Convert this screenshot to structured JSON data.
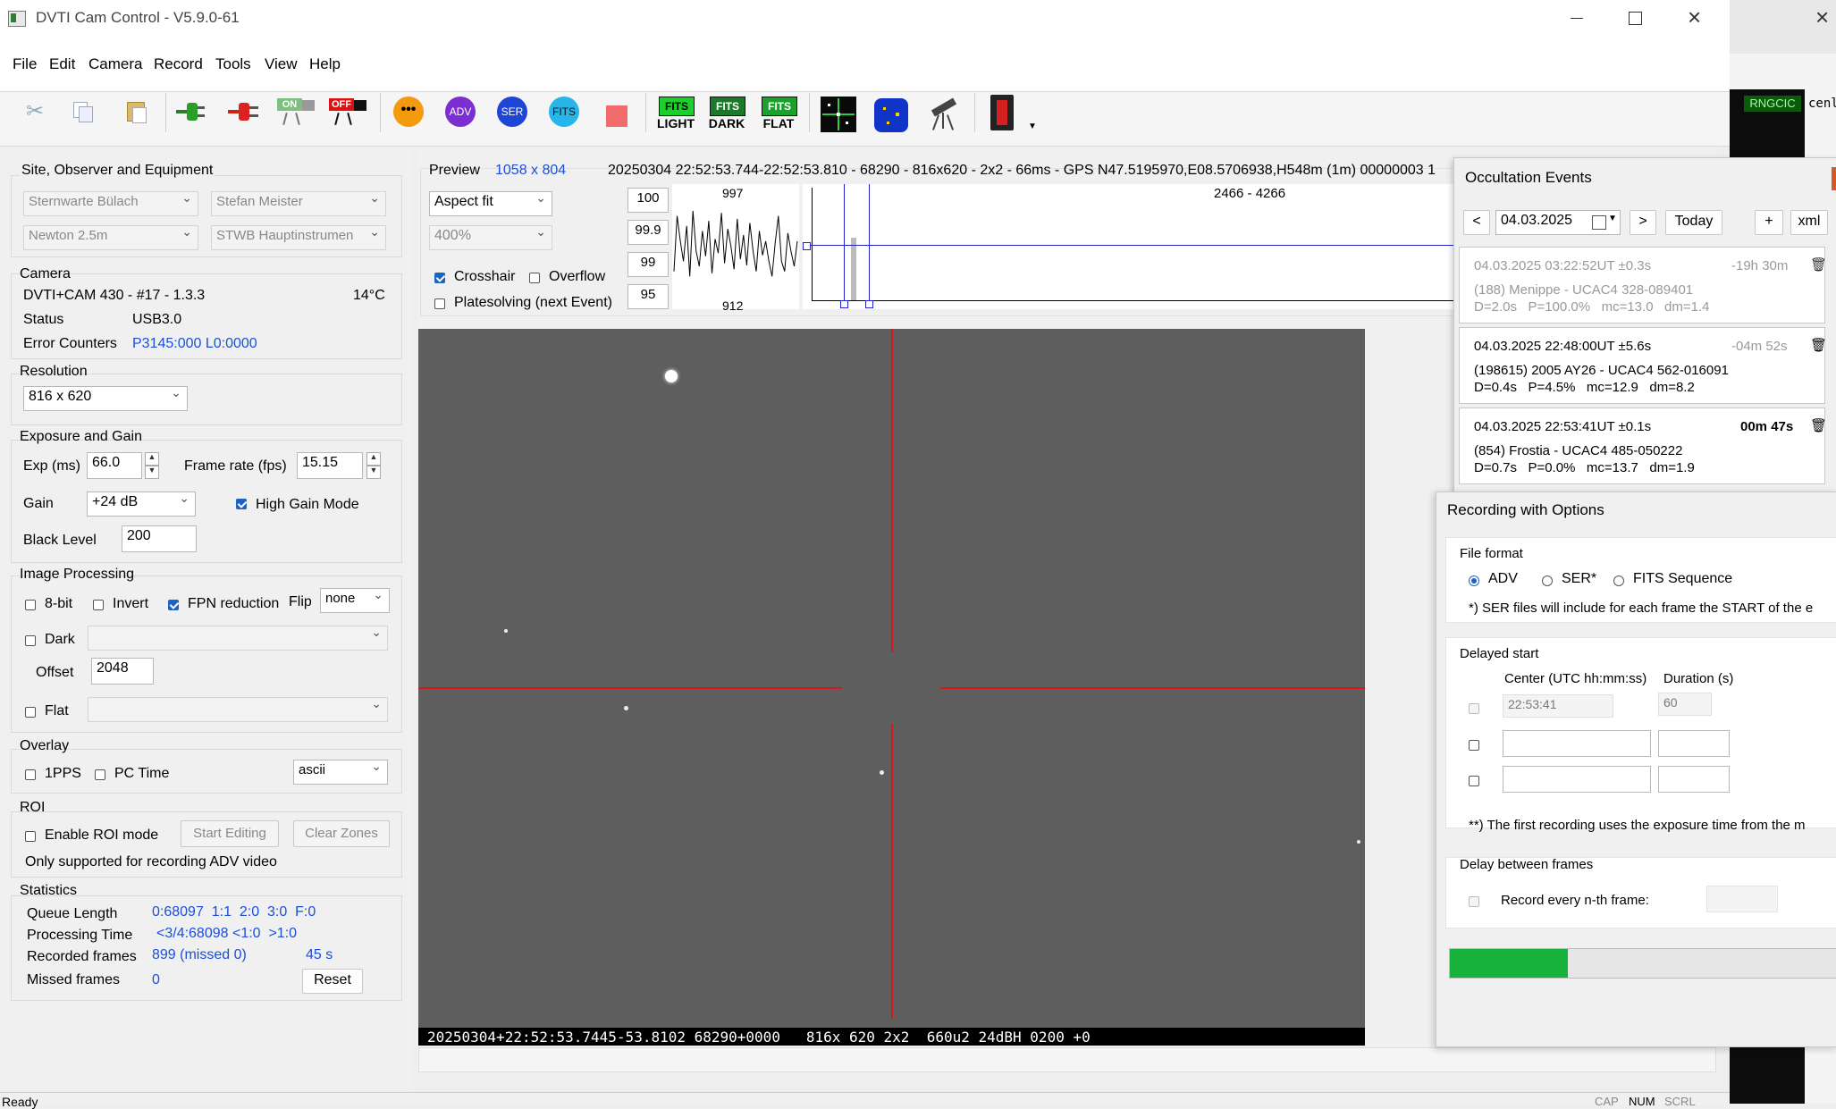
{
  "window": {
    "title": "DVTI Cam Control - V5.9.0-61"
  },
  "menu": [
    "File",
    "Edit",
    "Camera",
    "Record",
    "Tools",
    "View",
    "Help"
  ],
  "toolbar": {
    "on_label": "ON",
    "off_label": "OFF",
    "adv_label": "ADV",
    "ser_label": "SER",
    "fits_label": "FITS",
    "fits_light": [
      "FITS",
      "LIGHT"
    ],
    "fits_dark": [
      "FITS",
      "DARK"
    ],
    "fits_flat": [
      "FITS",
      "FLAT"
    ]
  },
  "site": {
    "title": "Site, Observer and Equipment",
    "observatory": "Sternwarte Bülach",
    "observer": "Stefan Meister",
    "telescope": "Newton 2.5m",
    "instrument": "STWB Hauptinstrumen"
  },
  "camera": {
    "title": "Camera",
    "model": "DVTI+CAM 430  -  #17  -  1.3.3",
    "temperature": "14°C",
    "status_label": "Status",
    "status_value": "USB3.0",
    "errors_label": "Error Counters",
    "errors_value": "P3145:000 L0:0000"
  },
  "resolution": {
    "title": "Resolution",
    "value": "816 x 620"
  },
  "exposure": {
    "title": "Exposure and Gain",
    "exp_label": "Exp (ms)",
    "exp_value": "66.0",
    "fps_label": "Frame rate (fps)",
    "fps_value": "15.15",
    "gain_label": "Gain",
    "gain_value": "+24 dB",
    "hgm_label": "High Gain Mode",
    "black_label": "Black Level",
    "black_value": "200"
  },
  "image_processing": {
    "title": "Image Processing",
    "bit8": "8-bit",
    "invert": "Invert",
    "fpn": "FPN reduction",
    "flip_label": "Flip",
    "flip_value": "none",
    "dark": "Dark",
    "offset_label": "Offset",
    "offset_value": "2048",
    "flat": "Flat"
  },
  "overlay": {
    "title": "Overlay",
    "pps": "1PPS",
    "pctime": "PC Time",
    "format": "ascii"
  },
  "roi": {
    "title": "ROI",
    "enable": "Enable ROI mode",
    "start": "Start Editing",
    "clear": "Clear Zones",
    "note": "Only supported for recording ADV video"
  },
  "stats": {
    "title": "Statistics",
    "queue_label": "Queue Length",
    "queue_value": "0:68097  1:1  2:0  3:0  F:0",
    "proc_label": "Processing Time",
    "proc_value": "<3/4:68098 <1:0  >1:0",
    "rec_label": "Recorded frames",
    "rec_value": "899 (missed 0)",
    "rec_time": "45 s",
    "missed_label": "Missed frames",
    "missed_value": "0",
    "reset": "Reset"
  },
  "preview": {
    "label": "Preview",
    "size": "1058 x 804",
    "info": "20250304 22:52:53.744-22:52:53.810 - 68290 - 816x620 - 2x2 - 66ms - GPS N47.5195970,E08.5706938,H548m (1m) 00000003 1",
    "fit": "Aspect fit",
    "zoom": "400%",
    "crosshair": "Crosshair",
    "overflow": "Overflow",
    "platesolving": "Platesolving (next Event)",
    "levels": [
      "100",
      "99.9",
      "99",
      "95"
    ],
    "hist_max": "997",
    "hist_min": "912",
    "range": "2466 - 4266",
    "timestamp": "20250304+22:52:53.7445-53.8102 68290+0000   816x 620 2x2  660u2 24dBH 0200 +0"
  },
  "chart_data": {
    "type": "line",
    "title": "",
    "ylim": [
      912,
      997
    ],
    "values": [
      930,
      985,
      960,
      940,
      975,
      925,
      990,
      950,
      935,
      970,
      945,
      980,
      928,
      962,
      948,
      988,
      938,
      972,
      955,
      932,
      982,
      942,
      966,
      936,
      978,
      950,
      930,
      970,
      946,
      960,
      940,
      925,
      958,
      985,
      940,
      930,
      968,
      950,
      935,
      960
    ]
  },
  "occultation": {
    "title": "Occultation Events",
    "date": "04.03.2025",
    "prev": "<",
    "next": ">",
    "today": "Today",
    "add": "+",
    "xml": "xml",
    "events": [
      {
        "time": "04.03.2025 03:22:52UT ±0.3s",
        "delta": "-19h 30m",
        "object": "(188) Menippe - UCAC4 328-089401",
        "params": "D=2.0s   P=100.0%   mc=13.0   dm=1.4"
      },
      {
        "time": "04.03.2025 22:48:00UT ±5.6s",
        "delta": "-04m 52s",
        "object": "(198615) 2005 AY26 - UCAC4 562-016091",
        "params": "D=0.4s   P=4.5%   mc=12.9   dm=8.2"
      },
      {
        "time": "04.03.2025 22:53:41UT ±0.1s",
        "delta": "00m 47s",
        "object": "(854) Frostia - UCAC4 485-050222",
        "params": "D=0.7s   P=0.0%   mc=13.7   dm=1.9"
      }
    ]
  },
  "recording": {
    "title": "Recording with Options",
    "file_format": "File format",
    "adv": "ADV",
    "ser": "SER*",
    "fits": "FITS Sequence",
    "ser_note": "*) SER files will include for each frame the START of the e",
    "delayed_start": "Delayed start",
    "center_label": "Center (UTC hh:mm:ss)",
    "duration_label": "Duration (s)",
    "center_value": "22:53:41",
    "duration_value": "60",
    "first_note": "**) The first recording uses the exposure time from the m",
    "delay_between": "Delay between frames",
    "every_nth": "Record every n-th frame:",
    "progress": 0.3
  },
  "background_window": {
    "tag": "RNGCIC",
    "text": "cenl"
  },
  "statusbar": {
    "text": "Ready",
    "caps": "CAP",
    "num": "NUM",
    "scrl": "SCRL"
  },
  "colors": {
    "accent": "#1b64c6",
    "crosshair": "#d11a1a",
    "progress": "#17b33d"
  }
}
